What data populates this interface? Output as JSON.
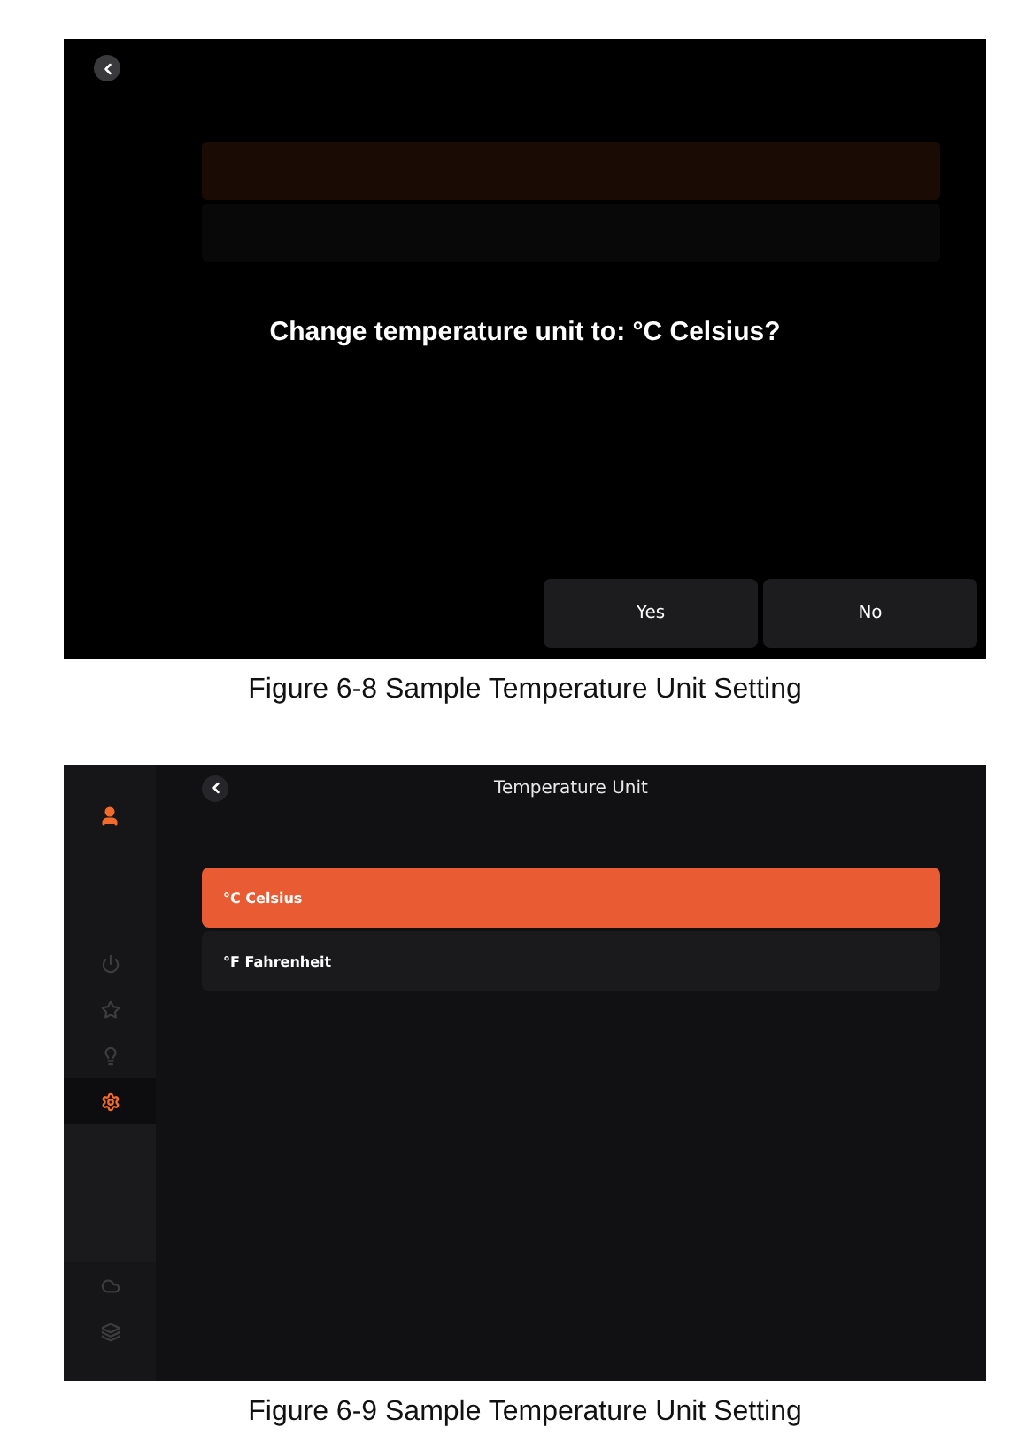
{
  "figures": [
    {
      "kind": "dialog",
      "dialog": {
        "message": "Change temperature unit to: °C Celsius?",
        "buttons": [
          "Yes",
          "No"
        ]
      },
      "caption": "Figure 6-8 Sample Temperature Unit Setting"
    },
    {
      "kind": "settings",
      "title": "Temperature Unit",
      "sidebar": {
        "items": [
          {
            "selected": false
          },
          {
            "selected": false
          },
          {
            "selected": false
          },
          {
            "selected": true
          },
          {
            "selected": false
          },
          {
            "selected": false
          }
        ]
      },
      "options": [
        {
          "label": "°C Celsius",
          "selected": true
        },
        {
          "label": "°F Fahrenheit",
          "selected": false
        }
      ],
      "caption": "Figure 6-9 Sample Temperature Unit Setting"
    }
  ]
}
